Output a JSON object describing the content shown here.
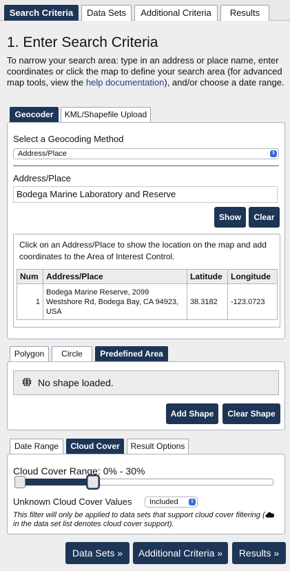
{
  "top_tabs": [
    "Search Criteria",
    "Data Sets",
    "Additional Criteria",
    "Results"
  ],
  "title": "1. Enter Search Criteria",
  "intro": {
    "before_link": "To narrow your search area: type in an address or place name, enter coordinates or click the map to define your search area (for advanced map tools, view the ",
    "link": "help documentation",
    "after_link": "), and/or choose a date range."
  },
  "location_tabs": [
    "Geocoder",
    "KML/Shapefile Upload"
  ],
  "geocoder": {
    "method_label": "Select a Geocoding Method",
    "method_value": "Address/Place",
    "address_label": "Address/Place",
    "address_value": "Bodega Marine Laboratory and Reserve",
    "show_button": "Show",
    "clear_button": "Clear",
    "instructions": "Click on an Address/Place to show the location on the map and add coordinates to the Area of Interest Control.",
    "table": {
      "headers": [
        "Num",
        "Address/Place",
        "Latitude",
        "Longitude"
      ],
      "rows": [
        {
          "num": "1",
          "address": "Bodega Marine Reserve, 2099 Westshore Rd, Bodega Bay, CA 94923, USA",
          "latitude": "38.3182",
          "longitude": "-123.0723"
        }
      ]
    }
  },
  "shape_tabs": [
    "Polygon",
    "Circle",
    "Predefined Area"
  ],
  "shape": {
    "status": "No shape loaded.",
    "status_icon": "globe-icon",
    "add_button": "Add Shape",
    "clear_button": "Clear Shape"
  },
  "filter_tabs": [
    "Date Range",
    "Cloud Cover",
    "Result Options"
  ],
  "cloud_cover": {
    "range_label": "Cloud Cover Range: 0% - 30%",
    "range_min_percent": 0,
    "range_max_percent": 30,
    "unknown_label": "Unknown Cloud Cover Values",
    "unknown_value": "Included",
    "note_before": "This filter will only be applied to data sets that support cloud cover filtering (",
    "note_icon": "cloud-icon",
    "note_after": " in the data set list denotes cloud cover support)."
  },
  "nav_buttons": [
    "Data Sets »",
    "Additional Criteria »",
    "Results »"
  ],
  "colors": {
    "accent": "#1d3557",
    "link": "#1d3f8a",
    "panel": "#eeeeee"
  }
}
